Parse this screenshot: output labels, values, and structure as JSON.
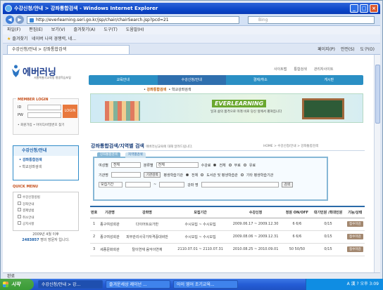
{
  "window": {
    "title": "수강신청/안내 > 강좌통합검색 - Windows Internet Explorer"
  },
  "address": {
    "url": "http://everlearning.seri.go.kr/jsp/chair/chairSearch.jsp?pcd=21",
    "search_placeholder": "Bing"
  },
  "menubar": [
    "파일(F)",
    "편집(E)",
    "보기(V)",
    "즐겨찾기(A)",
    "도구(T)",
    "도움말(H)"
  ],
  "favbar": {
    "favorites": "즐겨찾기",
    "item": "네이버 나의 경쟁력, 네..."
  },
  "tab": {
    "label": "수강신청/안내 > 강좌통합검색"
  },
  "tools": [
    "페이지(P)",
    "안전(S)",
    "도구(O)"
  ],
  "site": {
    "logo": "에버러닝",
    "logo_sub": "서울특별시교육청 평생학습포털",
    "toplinks": [
      "사이트맵",
      "통합검색",
      "관리자사이트"
    ],
    "gnb": [
      "교육안내",
      "수강신청/안내",
      "결제/취소",
      "게시판"
    ],
    "gnb_active": 1,
    "lnb": [
      "강좌통합검색",
      "학교강좌검색"
    ],
    "banner_title": "EVERLEARNING",
    "banner_sub": "일과 삶의 품격으로 미래 비로 당신 앞에서 펼쳐집니다",
    "member": {
      "heading": "MEMBER LOGIN",
      "id_label": "ID",
      "pw_label": "PW",
      "login": "LOGIN",
      "links": "• 회원가입  • 아이디/비밀번호 찾기"
    },
    "side": {
      "heading": "수강신청/안내",
      "items": [
        "강좌통합검색",
        "학교강좌검색"
      ]
    },
    "quick": {
      "heading": "QUICK MENU",
      "items": [
        "수강신청방법",
        "강좌안내",
        "결제방법",
        "취소안내",
        "공지사항"
      ]
    },
    "visit": {
      "line1": "2009년 4월 이후",
      "count": "2483857",
      "line2": "명의 방문자 입니다."
    },
    "page_title": "강좌통합검색/지역별 검색",
    "page_sub": "에버러닝교육에 대해 알려드립니다.",
    "breadcrumb": "HOME > 수강신청/안내 > 강좌통합검색",
    "search": {
      "tabs": [
        "강좌통합검색",
        "지역별검색"
      ],
      "agency_label": "여성별",
      "agency_value": "전체",
      "field_label": "분류별",
      "field_value": "전체",
      "fee_label": "수강료",
      "fee_options": [
        "전체",
        "무료",
        "유료"
      ],
      "org_label": "기관명",
      "org_button": "기관검색",
      "type_label": "평생학습기관",
      "type_options": [
        "전체",
        "도서관 및 평생학습관",
        "기타 평생학습기관"
      ],
      "period_select": "모집기간",
      "name_label": "강좌 명",
      "search_button": "검색"
    },
    "table": {
      "headers": [
        "번호",
        "기관명",
        "강좌명",
        "모집기간",
        "수강신청",
        "정원 ON/OFF",
        "대기인원 /최대인원",
        "기능/상태"
      ],
      "rows": [
        {
          "no": "1",
          "org": "종구여성회관",
          "course": "다이어트요가반",
          "period": "수시모집 ~ 수시모집",
          "dates": "2009.06.17 ~ 2009.12.30",
          "cap": "6 6/6",
          "wait": "0/15",
          "status": "접수마감"
        },
        {
          "no": "2",
          "org": "종구여성회관",
          "course": "피부관리사국가자격증대비반",
          "period": "수시모집 ~ 수시모집",
          "dates": "2009.08.06 ~ 2009.12.31",
          "cap": "6 6/6",
          "wait": "0/15",
          "status": "접수마감"
        },
        {
          "no": "3",
          "org": "세종문화회관",
          "course": "탈이연재 음악이연재",
          "period": "2110.07.01 ~ 2110.07.31",
          "dates": "2010.08.25 ~ 2010.09.01",
          "cap": "50 50/50",
          "wait": "0/15",
          "status": "접수마감"
        }
      ]
    }
  },
  "status": {
    "text": "완료"
  },
  "taskbar": {
    "start": "시작",
    "tasks": [
      "수강신청/안내 > 강...",
      "즐겨운세상 제이넌 ...",
      "아이 영어 조기교육..."
    ],
    "tray": "A 漢 ? 오후 3:09"
  }
}
